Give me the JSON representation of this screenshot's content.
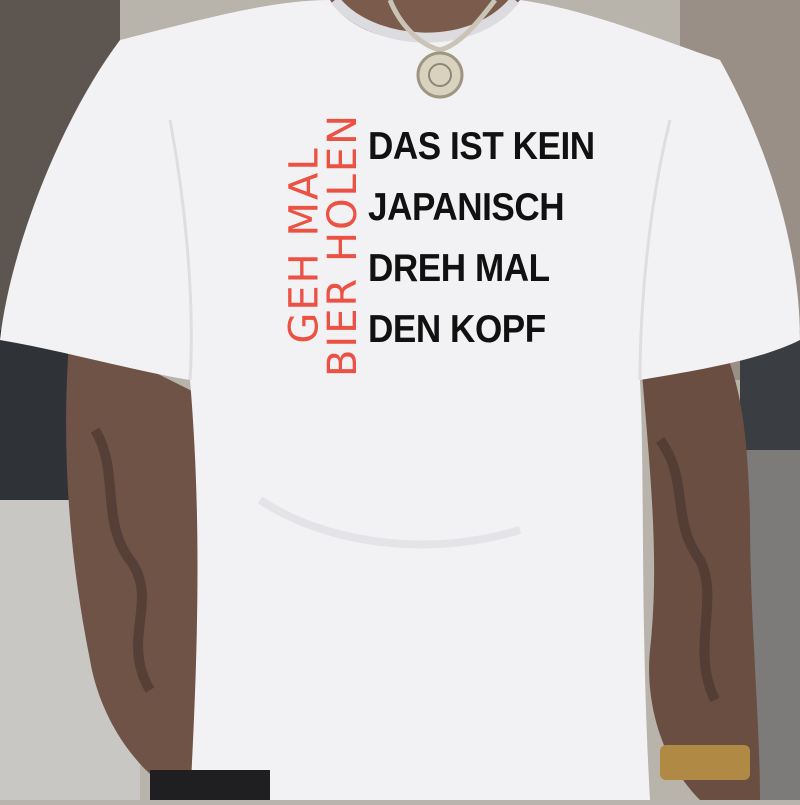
{
  "shirt_print": {
    "red_vertical_lines": [
      "GEH MAL",
      "BIER HOLEN"
    ],
    "black_lines": [
      "DAS IST KEIN",
      "JAPANISCH",
      "DREH MAL",
      "DEN KOPF"
    ],
    "colors": {
      "red_text": "#ec5243",
      "black_text": "#111111",
      "shirt": "#f2f2f4"
    }
  }
}
